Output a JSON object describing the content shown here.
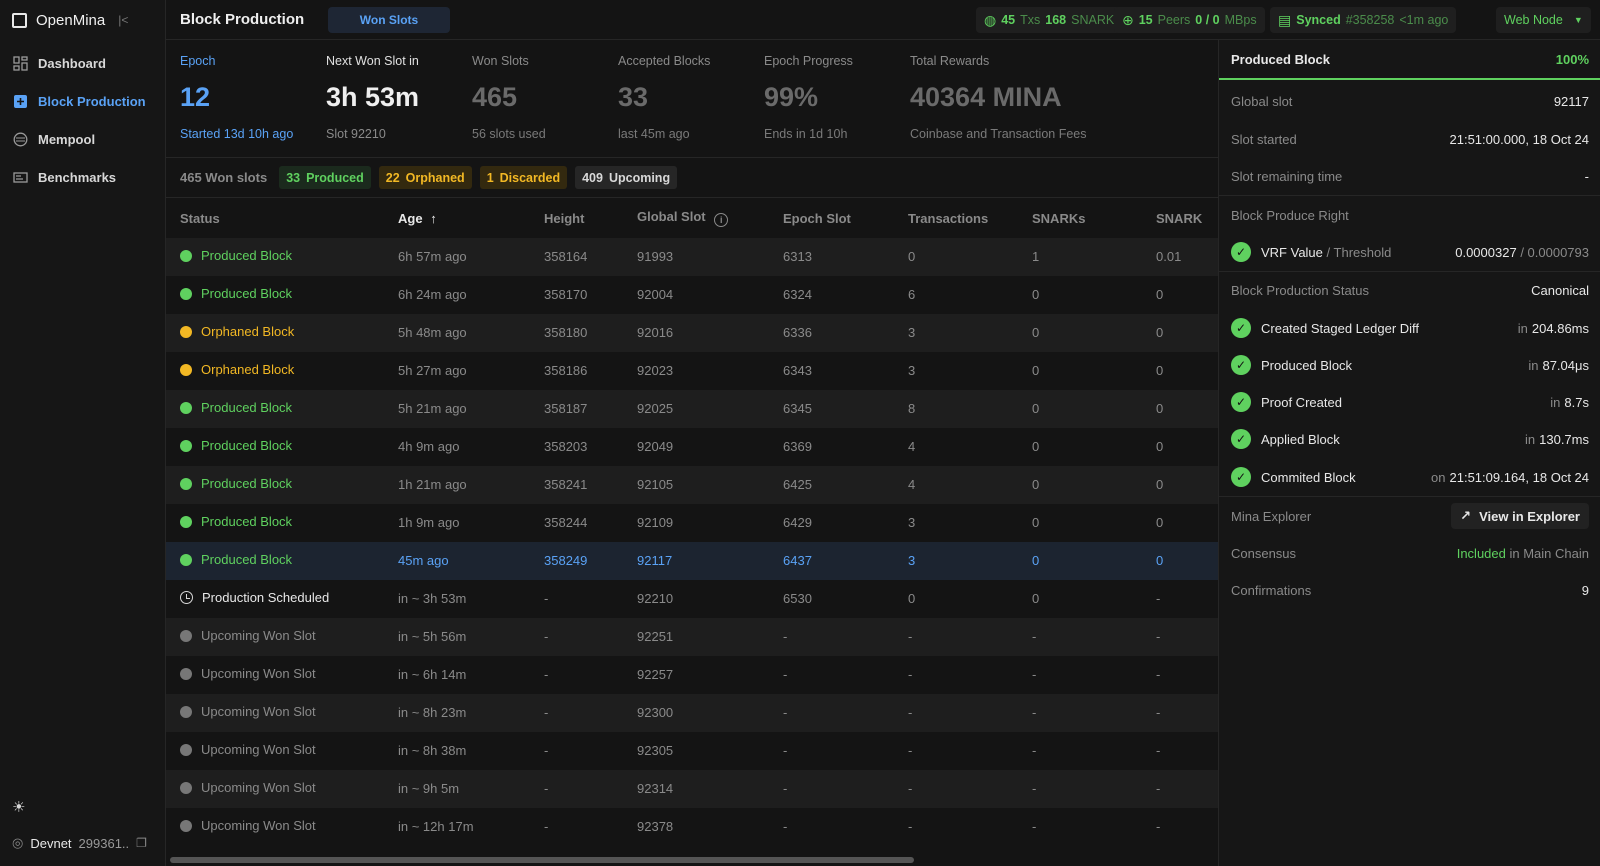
{
  "app": {
    "name": "OpenMina",
    "collapse_icon": "collapse-icon"
  },
  "sidebar": {
    "items": [
      {
        "label": "Dashboard",
        "icon": "dashboard-icon",
        "active": false
      },
      {
        "label": "Block Production",
        "icon": "block-production-icon",
        "active": true
      },
      {
        "label": "Mempool",
        "icon": "mempool-icon",
        "active": false
      },
      {
        "label": "Benchmarks",
        "icon": "benchmarks-icon",
        "active": false
      }
    ],
    "network": {
      "name": "Devnet",
      "hash": "299361.."
    }
  },
  "topbar": {
    "title": "Block Production",
    "tab": "Won Slots",
    "mempool": {
      "txs": "45",
      "txs_label": "Txs",
      "snarks": "168",
      "snarks_label": "SNARKs"
    },
    "peers": {
      "count": "15",
      "label": "Peers",
      "bandwidth": "0 / 0",
      "unit": "MBps"
    },
    "sync": {
      "status": "Synced",
      "block": "#358258",
      "age": "<1m ago"
    },
    "node": "Web Node"
  },
  "stats": {
    "epoch": {
      "label": "Epoch",
      "value": "12",
      "sub": "Started 13d 10h ago"
    },
    "next": {
      "label": "Next Won Slot in",
      "value": "3h 53m",
      "sub": "Slot 92210"
    },
    "won": {
      "label": "Won Slots",
      "value": "465",
      "sub": "56 slots used"
    },
    "accepted": {
      "label": "Accepted Blocks",
      "value": "33",
      "sub": "last 45m ago"
    },
    "progress": {
      "label": "Epoch Progress",
      "value": "99%",
      "sub": "Ends in 1d 10h"
    },
    "rewards": {
      "label": "Total Rewards",
      "value": "40364 MINA",
      "sub": "Coinbase and Transaction Fees"
    }
  },
  "summary": {
    "total": "465 Won slots",
    "produced": {
      "count": "33",
      "label": "Produced"
    },
    "orphaned": {
      "count": "22",
      "label": "Orphaned"
    },
    "discarded": {
      "count": "1",
      "label": "Discarded"
    },
    "upcoming": {
      "count": "409",
      "label": "Upcoming"
    }
  },
  "table": {
    "columns": [
      "Status",
      "Age",
      "Height",
      "Global Slot",
      "Epoch Slot",
      "Transactions",
      "SNARKs",
      "SNARK"
    ],
    "rows": [
      {
        "status": "Produced Block",
        "kind": "produced",
        "age": "6h 57m ago",
        "height": "358164",
        "global": "91993",
        "epoch": "6313",
        "txs": "0",
        "snarks": "1",
        "fees": "0.01"
      },
      {
        "status": "Produced Block",
        "kind": "produced",
        "age": "6h 24m ago",
        "height": "358170",
        "global": "92004",
        "epoch": "6324",
        "txs": "6",
        "snarks": "0",
        "fees": "0"
      },
      {
        "status": "Orphaned Block",
        "kind": "orphaned",
        "age": "5h 48m ago",
        "height": "358180",
        "global": "92016",
        "epoch": "6336",
        "txs": "3",
        "snarks": "0",
        "fees": "0"
      },
      {
        "status": "Orphaned Block",
        "kind": "orphaned",
        "age": "5h 27m ago",
        "height": "358186",
        "global": "92023",
        "epoch": "6343",
        "txs": "3",
        "snarks": "0",
        "fees": "0"
      },
      {
        "status": "Produced Block",
        "kind": "produced",
        "age": "5h 21m ago",
        "height": "358187",
        "global": "92025",
        "epoch": "6345",
        "txs": "8",
        "snarks": "0",
        "fees": "0"
      },
      {
        "status": "Produced Block",
        "kind": "produced",
        "age": "4h 9m ago",
        "height": "358203",
        "global": "92049",
        "epoch": "6369",
        "txs": "4",
        "snarks": "0",
        "fees": "0"
      },
      {
        "status": "Produced Block",
        "kind": "produced",
        "age": "1h 21m ago",
        "height": "358241",
        "global": "92105",
        "epoch": "6425",
        "txs": "4",
        "snarks": "0",
        "fees": "0"
      },
      {
        "status": "Produced Block",
        "kind": "produced",
        "age": "1h 9m ago",
        "height": "358244",
        "global": "92109",
        "epoch": "6429",
        "txs": "3",
        "snarks": "0",
        "fees": "0"
      },
      {
        "status": "Produced Block",
        "kind": "produced",
        "age": "45m ago",
        "height": "358249",
        "global": "92117",
        "epoch": "6437",
        "txs": "3",
        "snarks": "0",
        "fees": "0",
        "selected": true
      },
      {
        "status": "Production Scheduled",
        "kind": "scheduled",
        "age": "in ~ 3h 53m",
        "height": "-",
        "global": "92210",
        "epoch": "6530",
        "txs": "0",
        "snarks": "0",
        "fees": "-"
      },
      {
        "status": "Upcoming Won Slot",
        "kind": "upcoming",
        "age": "in ~ 5h 56m",
        "height": "-",
        "global": "92251",
        "epoch": "-",
        "txs": "-",
        "snarks": "-",
        "fees": "-"
      },
      {
        "status": "Upcoming Won Slot",
        "kind": "upcoming",
        "age": "in ~ 6h 14m",
        "height": "-",
        "global": "92257",
        "epoch": "-",
        "txs": "-",
        "snarks": "-",
        "fees": "-"
      },
      {
        "status": "Upcoming Won Slot",
        "kind": "upcoming",
        "age": "in ~ 8h 23m",
        "height": "-",
        "global": "92300",
        "epoch": "-",
        "txs": "-",
        "snarks": "-",
        "fees": "-"
      },
      {
        "status": "Upcoming Won Slot",
        "kind": "upcoming",
        "age": "in ~ 8h 38m",
        "height": "-",
        "global": "92305",
        "epoch": "-",
        "txs": "-",
        "snarks": "-",
        "fees": "-"
      },
      {
        "status": "Upcoming Won Slot",
        "kind": "upcoming",
        "age": "in ~ 9h 5m",
        "height": "-",
        "global": "92314",
        "epoch": "-",
        "txs": "-",
        "snarks": "-",
        "fees": "-"
      },
      {
        "status": "Upcoming Won Slot",
        "kind": "upcoming",
        "age": "in ~ 12h 17m",
        "height": "-",
        "global": "92378",
        "epoch": "-",
        "txs": "-",
        "snarks": "-",
        "fees": "-"
      }
    ]
  },
  "panel": {
    "title": "Produced Block",
    "percent": "100%",
    "global_slot": {
      "label": "Global slot",
      "value": "92117"
    },
    "slot_started": {
      "label": "Slot started",
      "value": "21:51:00.000, 18 Oct 24"
    },
    "slot_remaining": {
      "label": "Slot remaining time",
      "value": "-"
    },
    "produce_right": {
      "label": "Block Produce Right"
    },
    "vrf": {
      "label": "VRF Value",
      "label_dim": "/ Threshold",
      "value": "0.0000327",
      "threshold": "/ 0.0000793"
    },
    "production_status": {
      "label": "Block Production Status",
      "value": "Canonical"
    },
    "steps": [
      {
        "label": "Created Staged Ledger Diff",
        "prefix": "in",
        "value": "204.86ms"
      },
      {
        "label": "Produced Block",
        "prefix": "in",
        "value": "87.04μs"
      },
      {
        "label": "Proof Created",
        "prefix": "in",
        "value": "8.7s"
      },
      {
        "label": "Applied Block",
        "prefix": "in",
        "value": "130.7ms"
      },
      {
        "label": "Commited Block",
        "prefix": "on",
        "value": "21:51:09.164, 18 Oct 24"
      }
    ],
    "explorer": {
      "label": "Mina Explorer",
      "button": "View in Explorer"
    },
    "consensus": {
      "label": "Consensus",
      "value": "Included",
      "suffix": "in Main Chain"
    },
    "confirmations": {
      "label": "Confirmations",
      "value": "9"
    }
  },
  "colors": {
    "green": "#5fd15f",
    "orange": "#f2b824",
    "blue": "#5aa2f5",
    "background": "#141414"
  }
}
